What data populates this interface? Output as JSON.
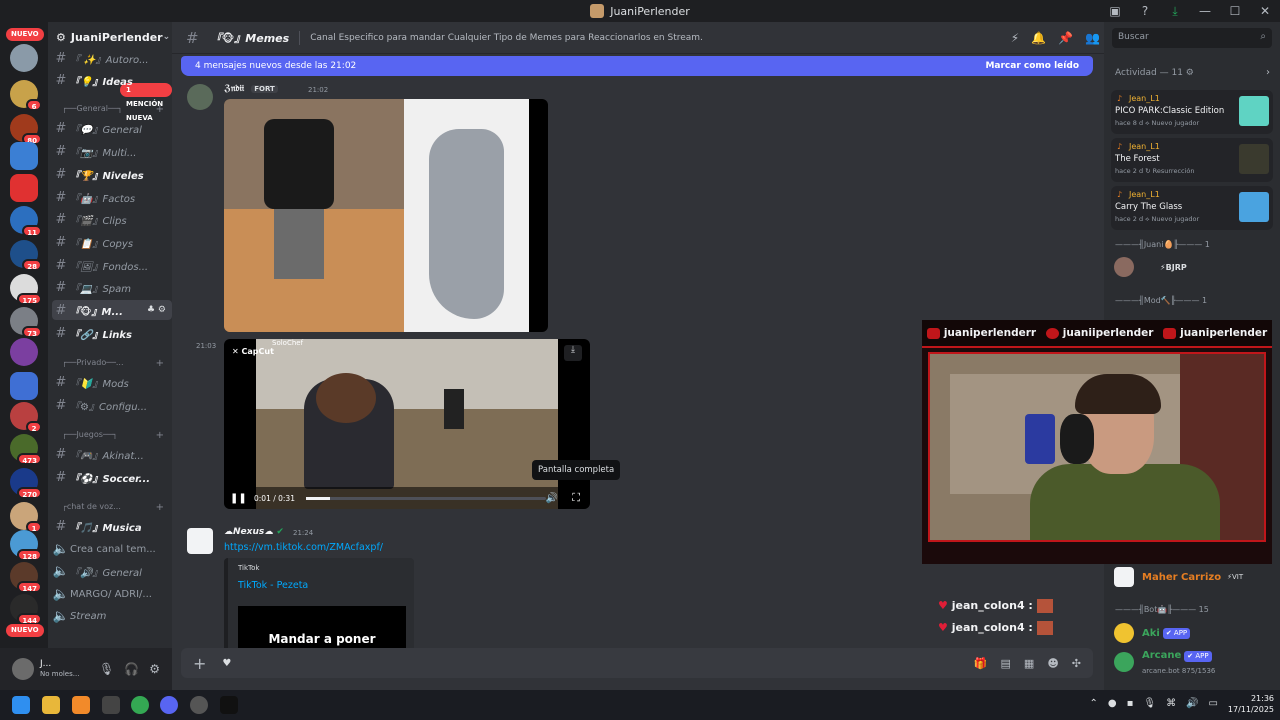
{
  "window": {
    "title": "JuaniPerlender"
  },
  "rail": {
    "new_pill_top": "NUEVO",
    "new_pill_bottom": "NUEVO",
    "badges": [
      "6",
      "80",
      "11",
      "28",
      "175",
      "73",
      "2",
      "473",
      "270",
      "1",
      "128",
      "147",
      "144"
    ]
  },
  "server": {
    "name": "JuaniPerlender",
    "mention_pill": "1 MENCIÓN NUEVA"
  },
  "channels": [
    {
      "label": "『 ✨』Autoro...",
      "type": "text"
    },
    {
      "label": "『💡』Ideas",
      "type": "text",
      "bold": true
    },
    {
      "label": "┌──General──┐",
      "type": "category"
    },
    {
      "label": "『💬』General",
      "type": "text"
    },
    {
      "label": "『📷』Multi...",
      "type": "text"
    },
    {
      "label": "『🏆』Niveles",
      "type": "text",
      "bold": true
    },
    {
      "label": "『🤖』Factos",
      "type": "text"
    },
    {
      "label": "『🎬』Clips",
      "type": "text"
    },
    {
      "label": "『📋』Copys",
      "type": "text"
    },
    {
      "label": "『🖼』Fondos...",
      "type": "text"
    },
    {
      "label": "『💻』Spam",
      "type": "text"
    },
    {
      "label": "『🐵』M...",
      "type": "text",
      "active": true
    },
    {
      "label": "『🔗』Links",
      "type": "text",
      "bold": true
    },
    {
      "label": "┌──Privado──...",
      "type": "category"
    },
    {
      "label": "『🔰』Mods",
      "type": "text"
    },
    {
      "label": "『⚙』Configu...",
      "type": "text"
    },
    {
      "label": "┌──Juegos──┐",
      "type": "category"
    },
    {
      "label": "『🎮』Akinat...",
      "type": "text"
    },
    {
      "label": "『⚽』Soccer...",
      "type": "text",
      "bold": true
    },
    {
      "label": "┌chat de voz...",
      "type": "category"
    },
    {
      "label": "『🎵』Musica",
      "type": "text",
      "bold": true
    },
    {
      "label": "Crea canal tem...",
      "type": "voice"
    },
    {
      "label": "『🔊』General",
      "type": "voice"
    },
    {
      "label": "MARGO/ ADRI/...",
      "type": "voice"
    },
    {
      "label": "Stream",
      "type": "voice"
    }
  ],
  "user_panel": {
    "name": "J...",
    "status": "No moles..."
  },
  "header": {
    "channel_title": "『🐵』Memes",
    "topic": "Canal Especifico para mandar Cualquier Tipo de Memes para Reaccionarlos en Stream."
  },
  "new_messages_bar": {
    "text": "4 mensajes nuevos desde las 21:02",
    "mark_read": "Marcar como leído"
  },
  "messages": [
    {
      "author": "ℨ𝔫𝔡𝔦𝔦",
      "role_tag": "FORT",
      "time": "21:02"
    },
    {
      "author": "",
      "time": "21:03",
      "video": {
        "time_label": "0:01 / 0:31",
        "overlay_brand": "CapCut",
        "overlay_user": "SoloChef",
        "tooltip": "Pantalla completa"
      }
    },
    {
      "author": "Nexus",
      "time": "21:24",
      "link": "https://vm.tiktok.com/ZMAcfaxpf/",
      "embed": {
        "provider": "TikTok",
        "title": "TikTok - Pezeta",
        "preview_text": "Mandar a poner"
      }
    }
  ],
  "chat_overlay": [
    {
      "user": "jean_colon4 :"
    },
    {
      "user": "jean_colon4 :"
    }
  ],
  "search": {
    "placeholder": "Buscar"
  },
  "activity": {
    "header": "Actividad — 11",
    "cards": [
      {
        "user": "Jean_L1",
        "game": "PICO PARK:Classic Edition",
        "meta": "hace 8 d  ⟡ Nuevo jugador"
      },
      {
        "user": "Jean_L1",
        "game": "The Forest",
        "meta": "hace 2 d  ↻ Resurrección"
      },
      {
        "user": "Jean_L1",
        "game": "Carry The Glass",
        "meta": "hace 2 d  ⟡ Nuevo jugador"
      }
    ]
  },
  "members": {
    "cat_juani": "———╢Juani🥚╟——— 1",
    "juani_tag": "⚡BJRP",
    "cat_mod": "———╢Mod🔨╟——— 1",
    "cat_bot": "———╢Bot🤖╟——— 15",
    "list": [
      {
        "name": "Maher Carrizo",
        "tag": "⚡VIT",
        "color": "#e67e22"
      },
      {
        "name": "Aki",
        "tag": "✔ APP",
        "color": "#3ba55c"
      },
      {
        "name": "Arcane",
        "tag": "✔ APP",
        "sub": "arcane.bot 875/1536",
        "color": "#3ba55c"
      }
    ]
  },
  "stream_social": [
    {
      "platform": "x",
      "handle": "juaniperlenderr"
    },
    {
      "platform": "instagram",
      "handle": "juaniiperlender"
    },
    {
      "platform": "youtube",
      "handle": "juaniperlender"
    }
  ],
  "taskbar": {
    "time": "21:36",
    "date": "17/11/2025"
  }
}
